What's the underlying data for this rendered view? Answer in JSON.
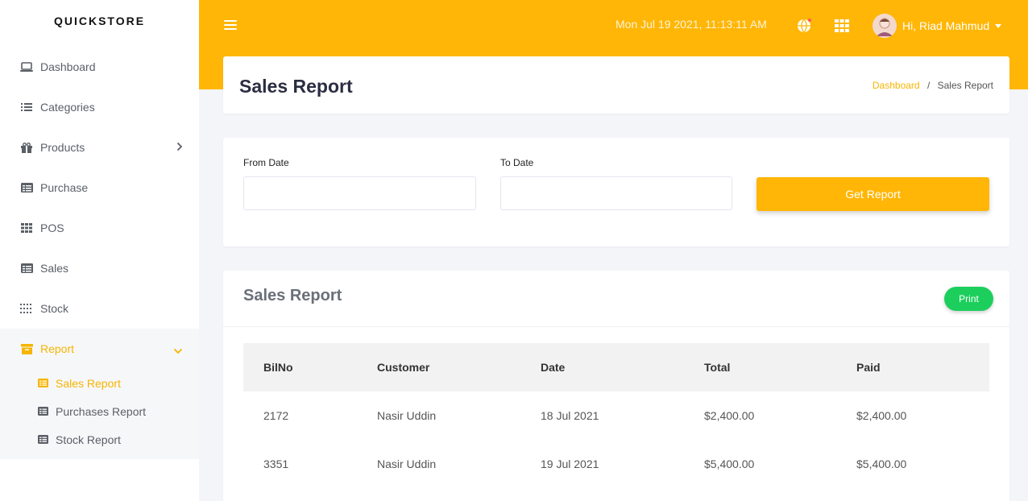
{
  "brand": "QUICKSTORE",
  "sidebar": {
    "items": [
      {
        "label": "Dashboard",
        "icon": "laptop-icon"
      },
      {
        "label": "Categories",
        "icon": "list-icon"
      },
      {
        "label": "Products",
        "icon": "gift-icon"
      },
      {
        "label": "Purchase",
        "icon": "table-icon"
      },
      {
        "label": "POS",
        "icon": "grid-icon"
      },
      {
        "label": "Sales",
        "icon": "table-icon"
      },
      {
        "label": "Stock",
        "icon": "dots-grid-icon"
      },
      {
        "label": "Report",
        "icon": "archive-icon"
      }
    ],
    "report_submenu": [
      {
        "label": "Sales Report",
        "icon": "table-icon"
      },
      {
        "label": "Purchases Report",
        "icon": "table-icon"
      },
      {
        "label": "Stock Report",
        "icon": "table-icon"
      }
    ]
  },
  "topbar": {
    "datetime": "Mon Jul 19 2021, 11:13:11 AM",
    "greeting": "Hi, Riad Mahmud"
  },
  "page": {
    "title": "Sales Report",
    "breadcrumb": {
      "home": "Dashboard",
      "separator": "/",
      "current": "Sales Report"
    }
  },
  "filter": {
    "from_label": "From Date",
    "to_label": "To Date",
    "from_value": "",
    "to_value": "",
    "button": "Get Report"
  },
  "report": {
    "title": "Sales Report",
    "print_label": "Print",
    "columns": [
      "BilNo",
      "Customer",
      "Date",
      "Total",
      "Paid"
    ],
    "rows": [
      [
        "2172",
        "Nasir Uddin",
        "18 Jul 2021",
        "$2,400.00",
        "$2,400.00"
      ],
      [
        "3351",
        "Nasir Uddin",
        "19 Jul 2021",
        "$5,400.00",
        "$5,400.00"
      ]
    ]
  },
  "colors": {
    "accent": "#ffb606",
    "print_button": "#1ccf5c",
    "sidebar_text": "#5a5f66"
  }
}
